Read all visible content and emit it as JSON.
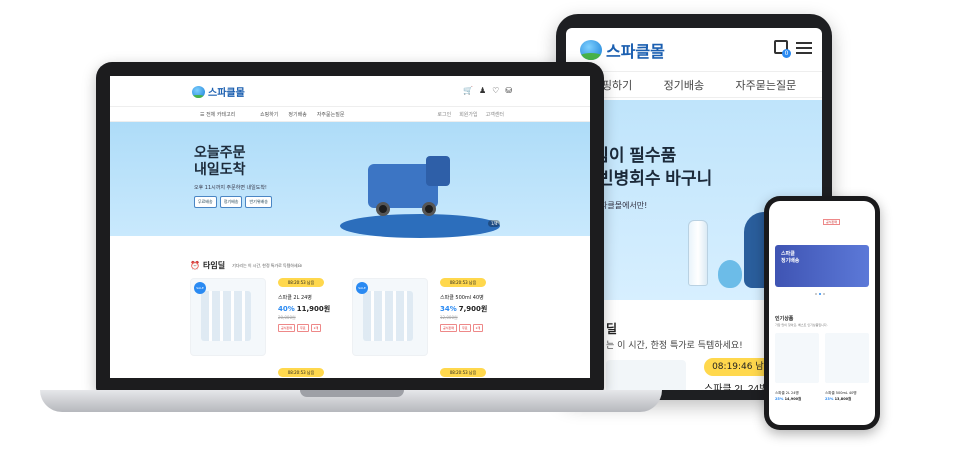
{
  "brand": {
    "name": "스파클몰",
    "accent": "#2a8af2",
    "logo_color": "#1b5fb0",
    "timer_color": "#ffd84d"
  },
  "tablet": {
    "nav": [
      "쇼핑하기",
      "정기배송",
      "자주묻는질문"
    ],
    "cart_count": "0",
    "hero_title_1": "경지킴이 필수품",
    "hero_title_2": "파클 빈병회수 바구니",
    "hero_sub": "파클몰에서만!",
    "section_title": "딜",
    "section_sub": "는 이 시간, 한정 특가로 득템하세요!",
    "timer": "08:19:46 남음",
    "product_name": "스파클 2L 24병"
  },
  "laptop": {
    "top_icons": [
      "cart-icon",
      "user-icon",
      "heart-icon",
      "truck-icon"
    ],
    "category_label": "전체 카테고리",
    "menu": [
      "쇼핑하기",
      "정기배송",
      "자주묻는질문"
    ],
    "util": [
      "로그인",
      "회원가입",
      "고객센터"
    ],
    "hero_title_1": "오늘주문",
    "hero_title_2": "내일도착",
    "hero_sub": "오후 11시까지 주문하면 내일도착!",
    "hero_tags": [
      "무료배송",
      "정기배송",
      "반기위배송"
    ],
    "hero_page": "1/4",
    "deal_title": "타임딜",
    "deal_sub": "기다리는 이 시간, 한정 특가로 득템하세요!",
    "cards": [
      {
        "sale": "SALE",
        "timer": "08:20:53 남음",
        "name": "스파클 2L 24병",
        "pct": "40%",
        "price": "11,900원",
        "orig": "20,000원",
        "badges": [
          "공식판매",
          "무료",
          "2개"
        ]
      },
      {
        "sale": "SALE",
        "timer": "08:20:53 남음",
        "name": "스파클 500ml 40병",
        "pct": "34%",
        "price": "7,900원",
        "orig": "12,000원",
        "badges": [
          "공식판매",
          "무료",
          "2개"
        ]
      }
    ],
    "next_timers": [
      "08:20:53 남음",
      "08:20:53 남음"
    ]
  },
  "phone": {
    "top_tag": "공식판매",
    "banner_title_1": "스파클",
    "banner_title_2": "정기배송",
    "section_title": "인기상품",
    "section_sub": "가장 많이 찾아요, 베스트 인기상품입니다.",
    "products": [
      {
        "name": "스파클 2L 24병",
        "pct": "25%",
        "price": "14,900원"
      },
      {
        "name": "스파클 500mL 40병",
        "pct": "23%",
        "price": "13,800원"
      }
    ]
  }
}
